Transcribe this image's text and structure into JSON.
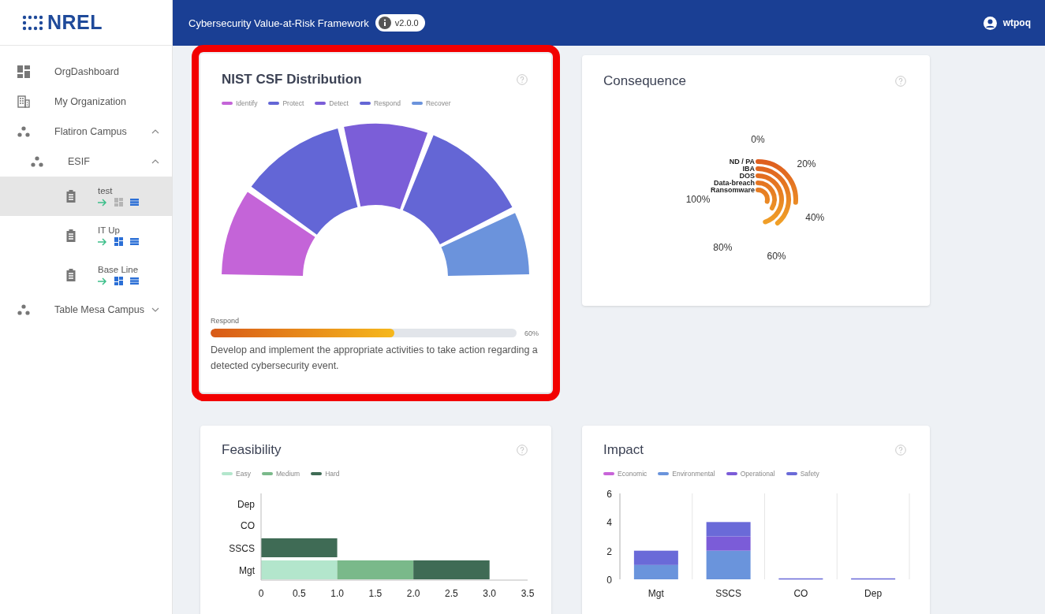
{
  "sidebar": {
    "logo": "NREL",
    "items": [
      {
        "kind": "dashboard",
        "label": "OrgDashboard",
        "selected": false
      },
      {
        "kind": "organization",
        "label": "My Organization",
        "selected": false
      },
      {
        "kind": "site",
        "label": "Flatiron Campus",
        "expanded": true,
        "selected": false,
        "children": [
          {
            "kind": "site",
            "label": "ESIF",
            "expanded": true,
            "selected": false,
            "children": [
              {
                "kind": "assessment",
                "label": "test",
                "selected": true
              },
              {
                "kind": "assessment",
                "label": "IT Up",
                "selected": false
              },
              {
                "kind": "assessment",
                "label": "Base Line",
                "selected": false
              }
            ]
          }
        ]
      },
      {
        "kind": "site",
        "label": "Table Mesa Campus",
        "expanded": false,
        "selected": false
      }
    ]
  },
  "header": {
    "title": "Cybersecurity Value-at-Risk Framework",
    "version": "v2.0.0",
    "user": "wtpoq"
  },
  "nist": {
    "title": "NIST CSF Distribution",
    "highlighted": true,
    "legend": [
      {
        "label": "Identify",
        "color": "#c464d8"
      },
      {
        "label": "Protect",
        "color": "#6366d6"
      },
      {
        "label": "Detect",
        "color": "#7b5ed8"
      },
      {
        "label": "Respond",
        "color": "#6466d5"
      },
      {
        "label": "Recover",
        "color": "#6b93dc"
      }
    ],
    "progress": {
      "label": "Respond",
      "level": 0.6,
      "reading": "60%"
    },
    "description": "Develop and implement the appropriate activities to take action regarding a detected cybersecurity event."
  },
  "consequence": {
    "title": "Consequence",
    "scale_labels": [
      "0%",
      "20%",
      "40%",
      "60%",
      "80%",
      "100%"
    ],
    "categories": [
      "ND / PA",
      "IBA",
      "DOS",
      "Data-breach",
      "Ransomware"
    ]
  },
  "feasibility": {
    "title": "Feasibility",
    "chart_data": {
      "type": "bar",
      "orientation": "horizontal",
      "stacked": true,
      "categories": [
        "Dep",
        "CO",
        "SSCS",
        "Mgt"
      ],
      "series": [
        {
          "name": "Easy",
          "color": "#b3e6cc",
          "values": [
            0,
            0,
            0,
            1
          ]
        },
        {
          "name": "Medium",
          "color": "#7ab98a",
          "values": [
            0,
            0,
            0,
            1
          ]
        },
        {
          "name": "Hard",
          "color": "#3f6b55",
          "values": [
            0,
            0,
            1,
            1
          ]
        }
      ],
      "xlim": [
        0,
        3.5
      ],
      "xticks": [
        0,
        0.5,
        {
          "value": 1,
          "label": "1.0"
        },
        1.5,
        {
          "value": 2,
          "label": "2.0"
        },
        2.5,
        {
          "value": 3,
          "label": "3.0"
        },
        3.5
      ]
    }
  },
  "impact": {
    "title": "Impact",
    "chart_data": {
      "type": "bar",
      "orientation": "vertical",
      "stacked": true,
      "categories": [
        "Mgt",
        "SSCS",
        "CO",
        "Dep"
      ],
      "series": [
        {
          "name": "Economic",
          "color": "#c864d8",
          "values": [
            0,
            0,
            0,
            0
          ]
        },
        {
          "name": "Environmental",
          "color": "#6a94dc",
          "values": [
            1,
            2,
            0,
            0
          ]
        },
        {
          "name": "Operational",
          "color": "#7b5cd8",
          "values": [
            0,
            1,
            0,
            0
          ]
        },
        {
          "name": "Safety",
          "color": "#6a6ad8",
          "values": [
            1,
            1,
            0,
            0
          ]
        }
      ],
      "ylim": [
        0,
        6
      ],
      "yticks": [
        0,
        2,
        4,
        6
      ]
    }
  }
}
